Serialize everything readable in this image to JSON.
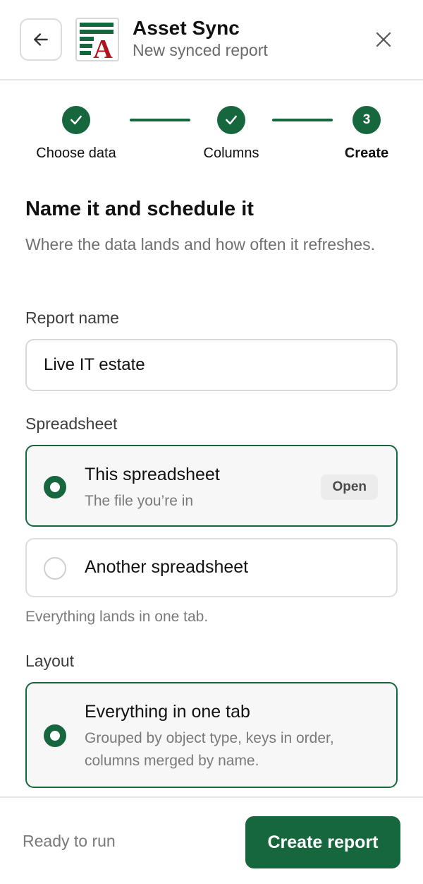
{
  "header": {
    "title": "Asset Sync",
    "subtitle": "New synced report",
    "back_icon": "arrow-left-icon",
    "close_icon": "close-icon",
    "logo_letter": "A"
  },
  "stepper": {
    "steps": [
      {
        "label": "Choose data",
        "state": "done"
      },
      {
        "label": "Columns",
        "state": "done"
      },
      {
        "label": "Create",
        "state": "active",
        "number": "3"
      }
    ]
  },
  "section": {
    "title": "Name it and schedule it",
    "description": "Where the data lands and how often it refreshes."
  },
  "report_name": {
    "label": "Report name",
    "value": "Live IT estate"
  },
  "spreadsheet": {
    "label": "Spreadsheet",
    "options": [
      {
        "title": "This spreadsheet",
        "subtitle": "The file you’re in",
        "badge": "Open",
        "selected": true
      },
      {
        "title": "Another spreadsheet",
        "selected": false
      }
    ],
    "hint": "Everything lands in one tab."
  },
  "layout": {
    "label": "Layout",
    "options": [
      {
        "title": "Everything in one tab",
        "subtitle": "Grouped by object type, keys in order, columns merged by name.",
        "selected": true
      }
    ]
  },
  "footer": {
    "status": "Ready to run",
    "primary_label": "Create report"
  },
  "colors": {
    "accent": "#17673e",
    "logo_green": "#17673e",
    "logo_red": "#b0141e"
  }
}
